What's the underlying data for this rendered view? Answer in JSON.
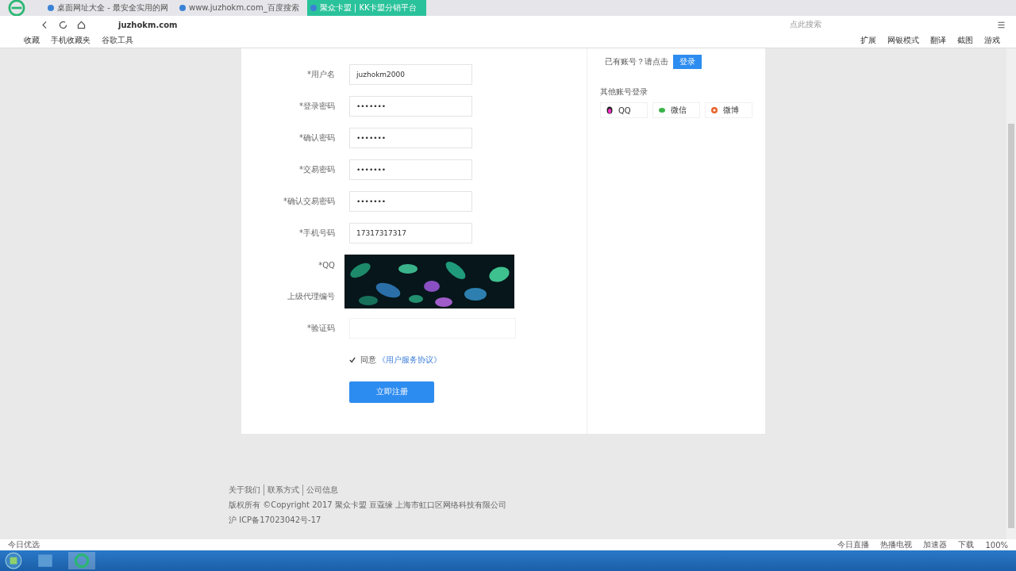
{
  "browser": {
    "tabs": [
      {
        "title": "桌面网址大全 - 最安全实用的网",
        "selected": false
      },
      {
        "title": "www.juzhokm.com_百度搜索",
        "selected": false
      },
      {
        "title": "聚众卡盟 | KK卡盟分销平台",
        "selected": true
      }
    ],
    "address": "juzhokm.com",
    "search_placeholder": "点此搜索",
    "bookmarks": [
      "收藏",
      "手机收藏夹",
      "谷歌工具"
    ],
    "extras": [
      "扩展",
      "网银模式",
      "翻译",
      "截图",
      "游戏"
    ]
  },
  "form": {
    "fields": [
      {
        "label": "*用户名",
        "kind": "text",
        "value": "juzhokm2000"
      },
      {
        "label": "*登录密码",
        "kind": "password",
        "value": "•••••••"
      },
      {
        "label": "*确认密码",
        "kind": "password",
        "value": "•••••••"
      },
      {
        "label": "*交易密码",
        "kind": "password",
        "value": "•••••••"
      },
      {
        "label": "*确认交易密码",
        "kind": "password",
        "value": "•••••••"
      },
      {
        "label": "*手机号码",
        "kind": "text",
        "value": "17317317317"
      },
      {
        "label": "*QQ",
        "kind": "covered"
      },
      {
        "label": "上级代理编号",
        "kind": "covered"
      },
      {
        "label": "*验证码",
        "kind": "captcha"
      }
    ],
    "agreement": {
      "checked": true,
      "text": "同意",
      "link": "《用户服务协议》"
    },
    "submit": "立即注册"
  },
  "side": {
    "prompt": "已有账号？请点击",
    "login": "登录",
    "title": "其他账号登录",
    "providers": [
      {
        "name": "QQ",
        "kind": "qq"
      },
      {
        "name": "微信",
        "kind": "wechat"
      },
      {
        "name": "微博",
        "kind": "weibo"
      }
    ]
  },
  "footer": {
    "links": [
      "关于我们",
      "联系方式",
      "公司信息"
    ],
    "copyright": "版权所有 ©Copyright 2017 聚众卡盟 豆蔻缘 上海市虹口区网络科技有限公司",
    "icp": "沪 ICP备17023042号-17"
  },
  "status_bar": {
    "left": "今日优选",
    "items": [
      "今日直播",
      "热播电视",
      "加速器",
      "下载"
    ],
    "zoom": "100%"
  }
}
